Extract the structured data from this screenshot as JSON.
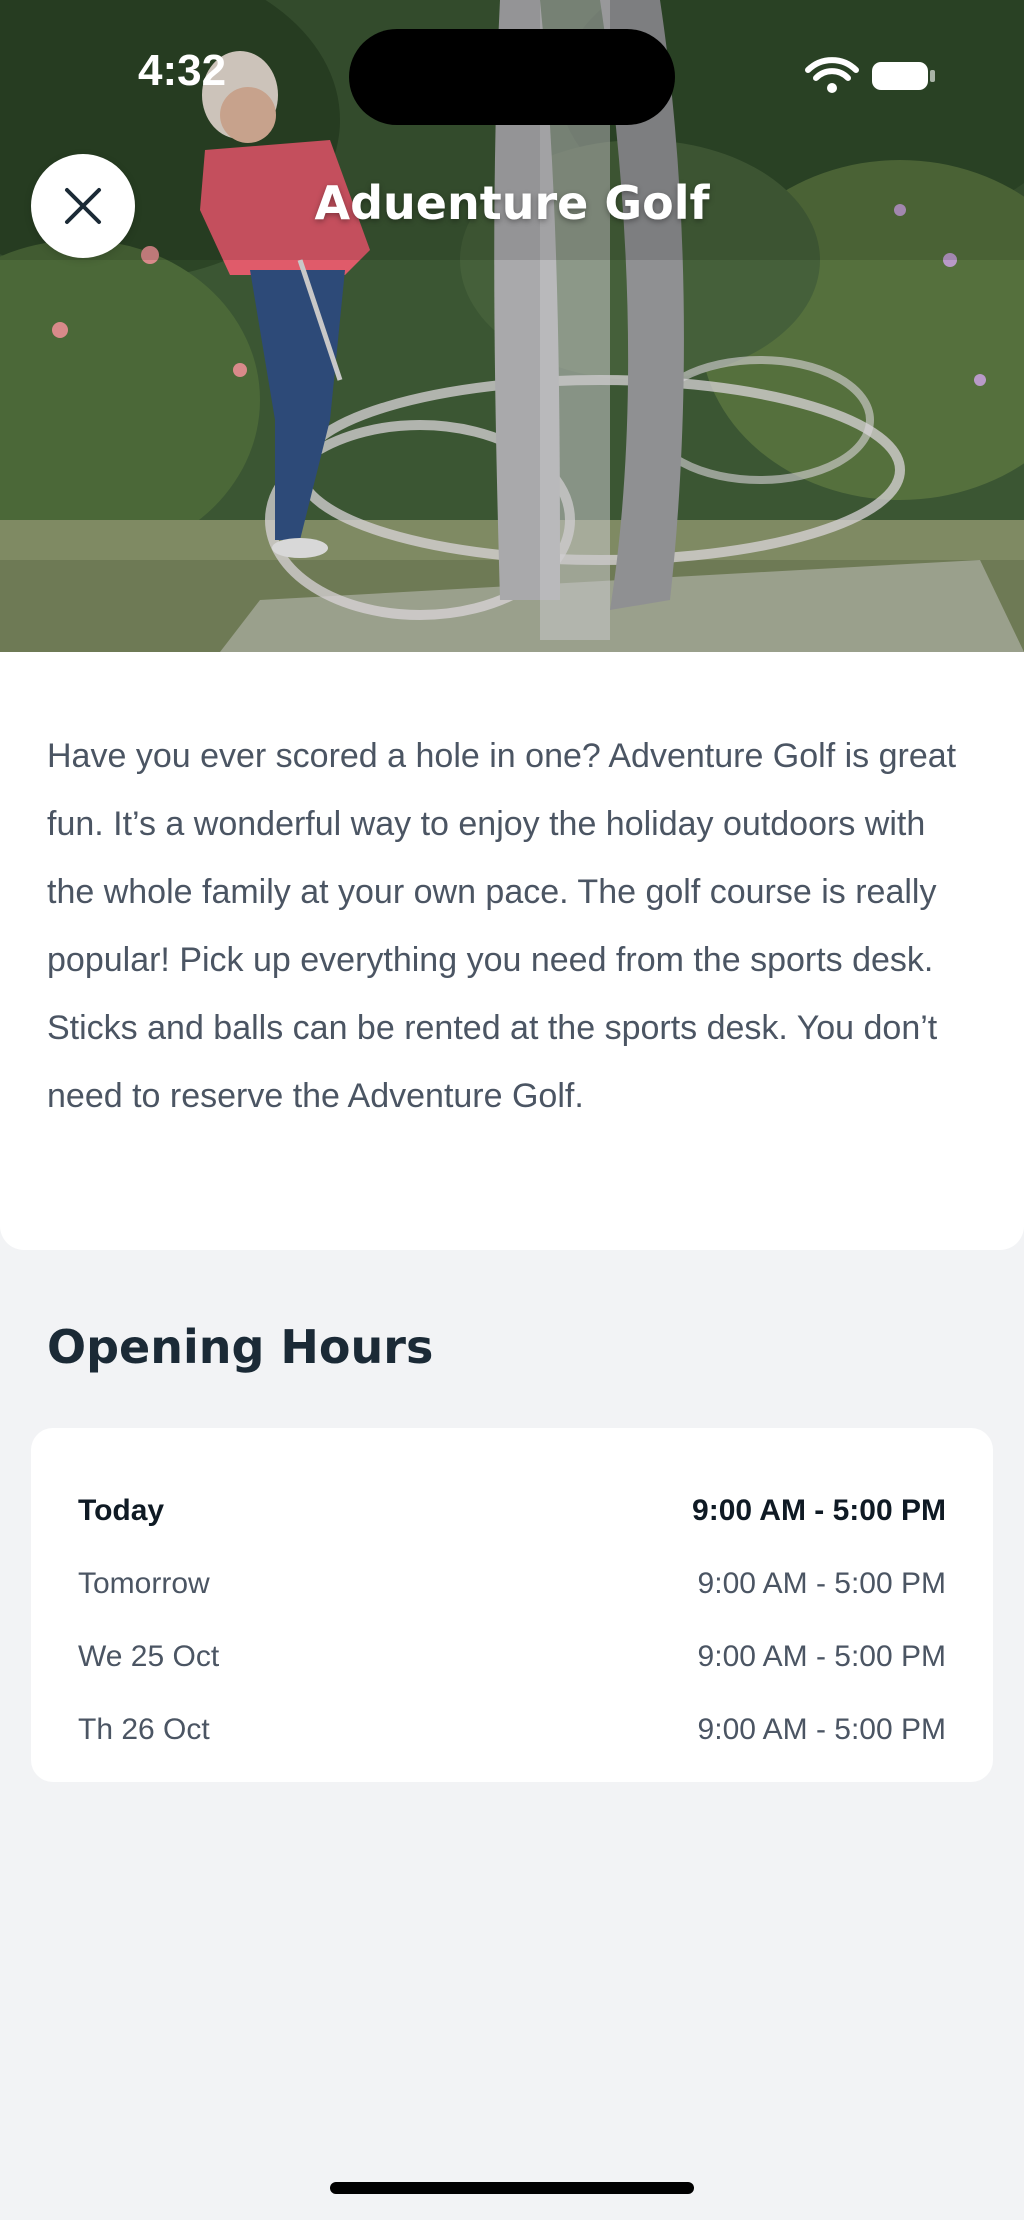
{
  "status_bar": {
    "time": "4:32",
    "icons": [
      "wifi-icon",
      "battery-icon"
    ]
  },
  "header": {
    "title": "Aduenture Golf",
    "close_icon": "close-icon"
  },
  "description": "Have you ever scored a hole in one? Adventure Golf is great fun. It’s a wonderful way to enjoy the holiday outdoors with the whole family at your own pace. The golf course is really popular! Pick up everything you need from the sports desk. Sticks and balls can be rented at the sports desk. You don’t need to reserve the Adventure Golf.",
  "opening_hours": {
    "title": "Opening Hours",
    "rows": [
      {
        "day": "Today",
        "hours": "9:00 AM - 5:00 PM"
      },
      {
        "day": "Tomorrow",
        "hours": "9:00 AM - 5:00 PM"
      },
      {
        "day": "We 25 Oct",
        "hours": "9:00 AM - 5:00 PM"
      },
      {
        "day": "Th 26 Oct",
        "hours": "9:00 AM - 5:00 PM"
      }
    ]
  },
  "colors": {
    "background": "#f2f3f5",
    "card": "#ffffff",
    "heading": "#1b2a36",
    "body_text": "#4b5563"
  }
}
